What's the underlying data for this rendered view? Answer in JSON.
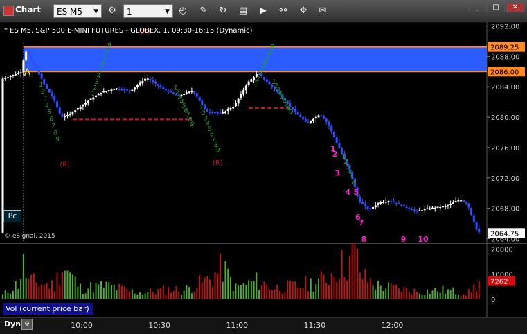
{
  "window": {
    "title": "Chart",
    "symbol": "ES M5",
    "interval": "1"
  },
  "legend": "* ES M5, S&P 500 E-MINI FUTURES - GLOBEX, 1, 09:30-16:15 (Dynamic)",
  "copyright": "© eSignal, 2015",
  "pc_label": "Pc",
  "vol_panel_label": "Vol (current price bar)",
  "dyn_label": "Dyn",
  "colors": {
    "accent_box": "#2a5cff",
    "orange_line": "#ff8a2a",
    "up_bar": "#ffffff",
    "down_bar": "#2b4fff",
    "magenta": "#ff22cc",
    "red_label": "#c01a1a",
    "green_label": "#22a022"
  },
  "chart_data": [
    {
      "type": "candlestick",
      "price_axis_ticks": [
        "2092.00",
        "2088.00",
        "2084.00",
        "2080.00",
        "2076.00",
        "2072.00",
        "2068.00",
        "2064.00"
      ],
      "ylim": [
        2063.5,
        2092.5
      ],
      "time_labels": [
        "10:00",
        "10:30",
        "11:00",
        "11:30",
        "12:00"
      ],
      "price_tags": [
        {
          "label": "2089.25",
          "value": 2089.25
        },
        {
          "label": "2086.00",
          "value": 2086.0
        },
        {
          "label": "2064.75",
          "value": 2064.75
        }
      ],
      "range_box": {
        "high": 2089.25,
        "low": 2086.0
      },
      "support_lines": [
        {
          "start_min": 27,
          "end_min": 73,
          "value": 2079.7
        },
        {
          "start_min": 95,
          "end_min": 112,
          "value": 2081.2
        }
      ],
      "price_path": [
        [
          0,
          2085.0
        ],
        [
          8,
          2086.0
        ],
        [
          9,
          2089.0
        ],
        [
          10,
          2088.3
        ],
        [
          14,
          2086.0
        ],
        [
          17,
          2084.0
        ],
        [
          20,
          2082.5
        ],
        [
          23,
          2080.0
        ],
        [
          26,
          2080.3
        ],
        [
          32,
          2081.8
        ],
        [
          38,
          2083.2
        ],
        [
          44,
          2083.8
        ],
        [
          50,
          2083.5
        ],
        [
          56,
          2085.2
        ],
        [
          62,
          2083.8
        ],
        [
          68,
          2082.8
        ],
        [
          74,
          2083.5
        ],
        [
          79,
          2080.8
        ],
        [
          85,
          2080.5
        ],
        [
          90,
          2081.5
        ],
        [
          95,
          2084.5
        ],
        [
          99,
          2085.8
        ],
        [
          103,
          2084.5
        ],
        [
          108,
          2082.8
        ],
        [
          113,
          2080.8
        ],
        [
          118,
          2079.2
        ],
        [
          123,
          2080.4
        ],
        [
          126,
          2079.2
        ],
        [
          129,
          2077.0
        ],
        [
          132,
          2074.8
        ],
        [
          135,
          2072.5
        ],
        [
          138,
          2069.0
        ],
        [
          142,
          2067.8
        ],
        [
          146,
          2068.8
        ],
        [
          150,
          2069.0
        ],
        [
          155,
          2068.3
        ],
        [
          160,
          2067.6
        ],
        [
          165,
          2068.0
        ],
        [
          172,
          2068.3
        ],
        [
          177,
          2069.2
        ],
        [
          180,
          2068.6
        ],
        [
          184,
          2064.8
        ]
      ],
      "labels_r": [
        {
          "text": "(R)",
          "minute": 55,
          "value": 2091.0
        },
        {
          "text": "(R)",
          "minute": 24,
          "value": 2073.5
        },
        {
          "text": "(R)",
          "minute": 83,
          "value": 2073.7
        }
      ],
      "label_a": {
        "text": "A",
        "minute": 9.5,
        "value": 2085.5
      },
      "magenta_labels": [
        {
          "text": "1",
          "minute": 127.6,
          "value": 2075.5
        },
        {
          "text": "2",
          "minute": 128.3,
          "value": 2074.8
        },
        {
          "text": "3",
          "minute": 129.3,
          "value": 2072.3
        },
        {
          "text": "4",
          "minute": 133.3,
          "value": 2069.8
        },
        {
          "text": "5",
          "minute": 136.5,
          "value": 2069.8
        },
        {
          "text": "6",
          "minute": 137.2,
          "value": 2066.5
        },
        {
          "text": "7",
          "minute": 138.5,
          "value": 2065.8
        },
        {
          "text": "8",
          "minute": 139.5,
          "value": 2063.6
        },
        {
          "text": "9",
          "minute": 154.8,
          "value": 2063.6
        },
        {
          "text": "10",
          "minute": 162.4,
          "value": 2063.6
        }
      ],
      "green_sequences": [
        {
          "text": "1 2 3 4 5 6 7 8 9",
          "minute": 14,
          "start": 2084.0,
          "step": -0.9
        },
        {
          "text": "1 2 3 4 5 6 7 8 9",
          "minute": 34,
          "start": 2082.8,
          "step": 0.8
        },
        {
          "text": "1 2 3 4 5 6 7 8 9",
          "minute": 66,
          "start": 2083.6,
          "step": -0.6
        },
        {
          "text": "1 2 3 4 5 6 7 8 9",
          "minute": 76,
          "start": 2081.0,
          "step": -0.7
        },
        {
          "text": "1 2 3 4 5 6 7 8 9",
          "minute": 97,
          "start": 2084.2,
          "step": 0.6
        },
        {
          "text": "1 2 3 4 5 6 7 8 9",
          "minute": 104,
          "start": 2084.4,
          "step": -0.5
        },
        {
          "text": "1 2 3 4 5 6",
          "minute": 131,
          "start": 2074.6,
          "step": -0.7
        }
      ],
      "volume_ticks": [
        "20000",
        "10000",
        "0"
      ],
      "volume_ylim": [
        0,
        22000
      ],
      "volume_current": {
        "label": "7262",
        "value": 7262
      },
      "volume_profile": [
        [
          0,
          2000
        ],
        [
          6,
          7000
        ],
        [
          8,
          15000
        ],
        [
          10,
          8000
        ],
        [
          20,
          6000
        ],
        [
          23,
          15000
        ],
        [
          30,
          5000
        ],
        [
          40,
          6000
        ],
        [
          50,
          3500
        ],
        [
          55,
          3000
        ],
        [
          65,
          4500
        ],
        [
          70,
          4000
        ],
        [
          80,
          9000
        ],
        [
          85,
          14000
        ],
        [
          90,
          5000
        ],
        [
          98,
          8000
        ],
        [
          105,
          5000
        ],
        [
          115,
          6000
        ],
        [
          125,
          9000
        ],
        [
          129,
          14000
        ],
        [
          133,
          16000
        ],
        [
          136,
          20000
        ],
        [
          139,
          10000
        ],
        [
          145,
          6000
        ],
        [
          160,
          3500
        ],
        [
          170,
          4000
        ],
        [
          180,
          3000
        ],
        [
          184,
          7262
        ]
      ]
    }
  ]
}
